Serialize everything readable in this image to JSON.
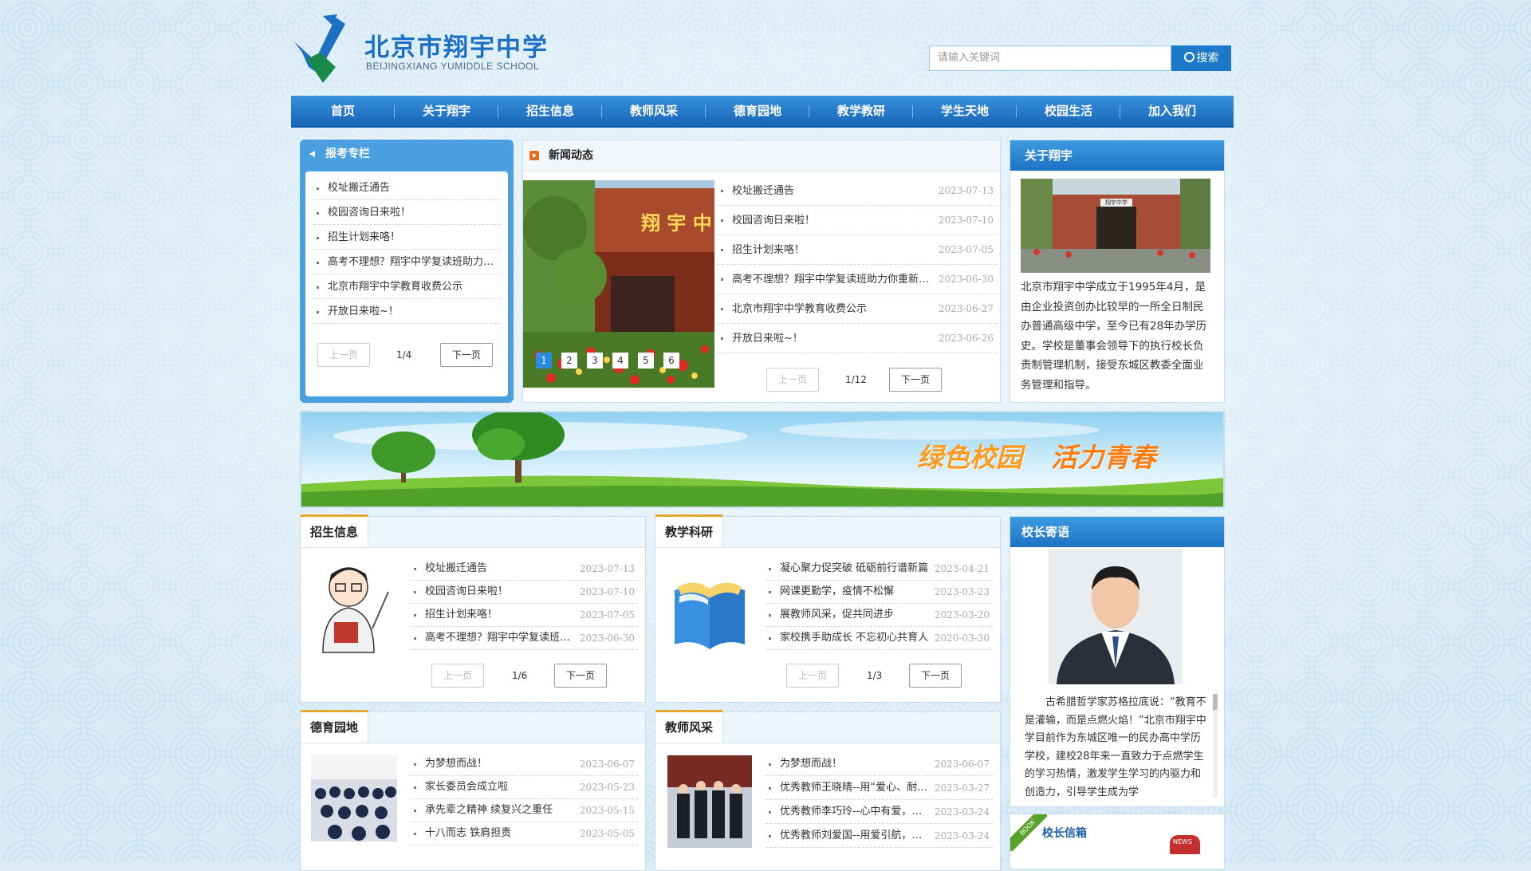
{
  "header": {
    "logo_cn": "北京市翔宇中学",
    "logo_en": "BEIJINGXIANG YUMIDDLE SCHOOL",
    "search_placeholder": "请输入关键词",
    "search_button": "搜索"
  },
  "nav": [
    "首页",
    "关于翔宇",
    "招生信息",
    "教师风采",
    "德育园地",
    "教学教研",
    "学生天地",
    "校园生活",
    "加入我们"
  ],
  "exam_column": {
    "title": "报考专栏",
    "items": [
      "校址搬迁通告",
      "校园咨询日来啦！",
      "招生计划来咯！",
      "高考不理想？翔宇中学复读班助力你重新起航",
      "北京市翔宇中学教育收费公示",
      "开放日来啦~！"
    ],
    "prev": "上一页",
    "next": "下一页",
    "page": "1/4"
  },
  "news": {
    "title": "新闻动态",
    "slider_dots": [
      "1",
      "2",
      "3",
      "4",
      "5",
      "6"
    ],
    "slider_caption": "翔 宇 中",
    "items": [
      {
        "text": "校址搬迁通告",
        "date": "2023-07-13"
      },
      {
        "text": "校园咨询日来啦！",
        "date": "2023-07-10"
      },
      {
        "text": "招生计划来咯！",
        "date": "2023-07-05"
      },
      {
        "text": "高考不理想？翔宇中学复读班助力你重新起航",
        "date": "2023-06-30"
      },
      {
        "text": "北京市翔宇中学教育收费公示",
        "date": "2023-06-27"
      },
      {
        "text": "开放日来啦~！",
        "date": "2023-06-26"
      }
    ],
    "prev": "上一页",
    "next": "下一页",
    "page": "1/12"
  },
  "about": {
    "title": "关于翔宇",
    "photo_sign": "翔宇中学",
    "text": "北京市翔宇中学成立于1995年4月，是由企业投资创办比较早的一所全日制民办普通高级中学，至今已有28年办学历史。学校是董事会领导下的执行校长负责制管理机制，接受东城区教委全面业务管理和指导。"
  },
  "banner": {
    "text1": "绿色校园",
    "text2": "活力青春"
  },
  "admission": {
    "title": "招生信息",
    "items": [
      {
        "text": "校址搬迁通告",
        "date": "2023-07-13"
      },
      {
        "text": "校园咨询日来啦！",
        "date": "2023-07-10"
      },
      {
        "text": "招生计划来咯！",
        "date": "2023-07-05"
      },
      {
        "text": "高考不理想？翔宇中学复读班助力你重新起航",
        "date": "2023-06-30"
      }
    ],
    "prev": "上一页",
    "next": "下一页",
    "page": "1/6"
  },
  "research": {
    "title": "教学科研",
    "items": [
      {
        "text": "凝心聚力促突破 砥砺前行谱新篇",
        "date": "2023-04-21"
      },
      {
        "text": "网课更勤学，疫情不松懈",
        "date": "2023-03-23"
      },
      {
        "text": "展教师风采，促共同进步",
        "date": "2023-03-20"
      },
      {
        "text": "家校携手助成长 不忘初心共育人",
        "date": "2020-03-30"
      }
    ],
    "prev": "上一页",
    "next": "下一页",
    "page": "1/3"
  },
  "principal": {
    "title": "校长寄语",
    "text": "古希腊哲学家苏格拉底说：“教育不是灌输，而是点燃火焰！”北京市翔宇中学目前作为东城区唯一的民办高中学历学校，建校28年来一直致力于点燃学生的学习热情，激发学生学习的内驱力和创造力，引导学生成为学"
  },
  "moral": {
    "title": "德育园地",
    "items": [
      {
        "text": "为梦想而战！",
        "date": "2023-06-07"
      },
      {
        "text": "家长委员会成立啦",
        "date": "2023-05-23"
      },
      {
        "text": "承先辈之精神 续复兴之重任",
        "date": "2023-05-15"
      },
      {
        "text": "十八而志 铁肩担责",
        "date": "2023-05-05"
      }
    ]
  },
  "teachers": {
    "title": "教师风采",
    "items": [
      {
        "text": "为梦想而战！",
        "date": "2023-06-07"
      },
      {
        "text": "优秀教师王晓晴--用“爱心、耐心、细心”浇灌",
        "date": "2023-03-27"
      },
      {
        "text": "优秀教师李巧玲--心中有爱，眼中有光",
        "date": "2023-03-24"
      },
      {
        "text": "优秀教师刘爱国--用爱引航，以心育人",
        "date": "2023-03-24"
      }
    ]
  },
  "mailbox": {
    "title": "校长信箱",
    "book": "BOOK",
    "news": "NEWS"
  },
  "colors": {
    "primary": "#1c78c9",
    "accent": "#e7a72a"
  }
}
